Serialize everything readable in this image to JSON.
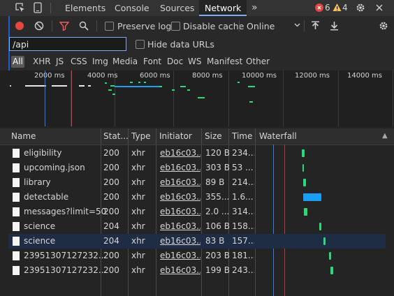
{
  "tabs": {
    "elements": "Elements",
    "console": "Console",
    "sources": "Sources",
    "network": "Network",
    "more": "»"
  },
  "badges": {
    "errors": "6",
    "warnings": "4"
  },
  "toolbar": {
    "preserve_log": "Preserve log",
    "disable_cache": "Disable cache",
    "throttle": "Online"
  },
  "filter": {
    "value": "/api",
    "hide_data_urls": "Hide data URLs"
  },
  "types": [
    "All",
    "XHR",
    "JS",
    "CSS",
    "Img",
    "Media",
    "Font",
    "Doc",
    "WS",
    "Manifest",
    "Other"
  ],
  "overview": {
    "ticks": [
      "2000 ms",
      "4000 ms",
      "6000 ms",
      "8000 ms",
      "10000 ms",
      "12000 ms",
      "14000 ms"
    ]
  },
  "columns": {
    "name": "Name",
    "status": "Stat...",
    "type": "Type",
    "initiator": "Initiator",
    "size": "Size",
    "time": "Time",
    "waterfall": "Waterfall",
    "sort": "▲"
  },
  "requests": [
    {
      "name": "eligibility",
      "status": "200",
      "type": "xhr",
      "initiator": "eb16c03...",
      "size": "120 B",
      "time": "234...",
      "wf_color": "#2bd97a"
    },
    {
      "name": "upcoming.json",
      "status": "200",
      "type": "xhr",
      "initiator": "eb16c03...",
      "size": "303 B",
      "time": "53 ...",
      "wf_color": "#2bd97a"
    },
    {
      "name": "library",
      "status": "200",
      "type": "xhr",
      "initiator": "eb16c03...",
      "size": "89 B",
      "time": "214...",
      "wf_color": "#2bd97a"
    },
    {
      "name": "detectable",
      "status": "200",
      "type": "xhr",
      "initiator": "eb16c03...",
      "size": "355...",
      "time": "1.6...",
      "wf_color": "#1a9df2"
    },
    {
      "name": "messages?limit=50",
      "status": "200",
      "type": "xhr",
      "initiator": "eb16c03...",
      "size": "2.0 ...",
      "time": "314...",
      "wf_color": "#2bd97a"
    },
    {
      "name": "science",
      "status": "204",
      "type": "xhr",
      "initiator": "eb16c03...",
      "size": "106 B",
      "time": "158...",
      "wf_color": "#2bd97a"
    },
    {
      "name": "science",
      "status": "204",
      "type": "xhr",
      "initiator": "eb16c03...",
      "size": "83 B",
      "time": "157...",
      "wf_color": "#2bd97a"
    },
    {
      "name": "23951307127232...",
      "status": "200",
      "type": "xhr",
      "initiator": "eb16c03...",
      "size": "203 B",
      "time": "181...",
      "wf_color": "#2bd97a"
    },
    {
      "name": "23951307127232...",
      "status": "200",
      "type": "xhr",
      "initiator": "eb16c03...",
      "size": "199 B",
      "time": "243...",
      "wf_color": "#2bd97a"
    }
  ],
  "selected_row": 6,
  "colors": {
    "accent": "#7cacf8",
    "record": "#e5463f",
    "error": "#e5463f",
    "warning": "#f7c548"
  }
}
